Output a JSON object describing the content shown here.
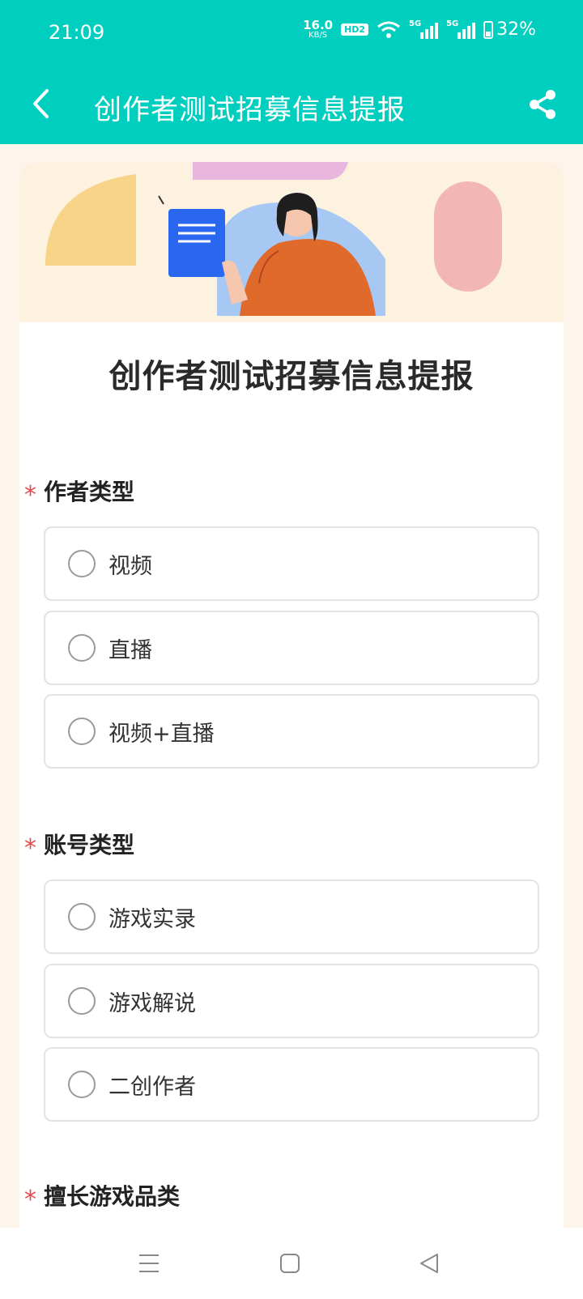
{
  "status_bar": {
    "time": "21:09",
    "net_speed_value": "16.0",
    "net_speed_unit": "KB/S",
    "hd_badge": "HD2",
    "signal1_label": "5G",
    "signal2_label": "5G",
    "battery_percent": "32%",
    "icons": [
      "wifi-icon",
      "signal-icon",
      "signal-icon",
      "battery-icon"
    ]
  },
  "header": {
    "title": "创作者测试招募信息提报",
    "back_icon": "chevron-left-icon",
    "share_icon": "share-icon",
    "bg_color": "#00cfc0"
  },
  "form": {
    "heading": "创作者测试招募信息提报",
    "required_mark": "*",
    "questions": [
      {
        "label": "作者类型",
        "options": [
          "视频",
          "直播",
          "视频+直播"
        ]
      },
      {
        "label": "账号类型",
        "options": [
          "游戏实录",
          "游戏解说",
          "二创作者"
        ]
      },
      {
        "label": "擅长游戏品类",
        "options": []
      }
    ]
  },
  "nav_bar": {
    "icons": [
      "menu-icon",
      "home-square-icon",
      "back-triangle-icon"
    ]
  }
}
